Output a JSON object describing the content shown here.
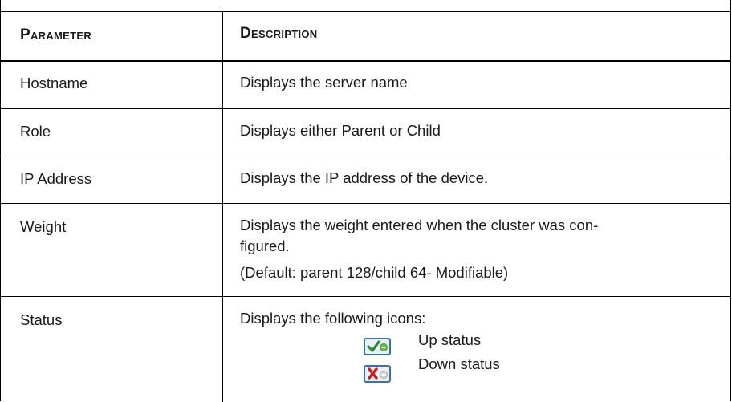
{
  "table": {
    "headers": {
      "parameter": "Parameter",
      "description": "Description"
    },
    "rows": [
      {
        "parameter": "Hostname",
        "description": [
          "Displays the server name"
        ]
      },
      {
        "parameter": "Role",
        "description": [
          "Displays either Parent or Child"
        ]
      },
      {
        "parameter": "IP Address",
        "description": [
          "Displays the IP address of the device."
        ]
      },
      {
        "parameter": "Weight",
        "description": [
          "Displays the weight entered when the cluster was con-",
          "figured.",
          "(Default: parent 128/child 64- Modifiable)"
        ]
      },
      {
        "parameter": "Status",
        "description": [
          "Displays the following icons:"
        ],
        "icons": [
          {
            "icon": "up-status-icon",
            "label": "Up status"
          },
          {
            "icon": "down-status-icon",
            "label": "Down status"
          }
        ]
      }
    ]
  },
  "colors": {
    "border": "#000000",
    "icon_frame": "#3a6fb0",
    "check": "#2e8b2e",
    "cross": "#cc1f1f",
    "up_dot": "#6cc24a",
    "down_dot": "#c8c8c8"
  }
}
